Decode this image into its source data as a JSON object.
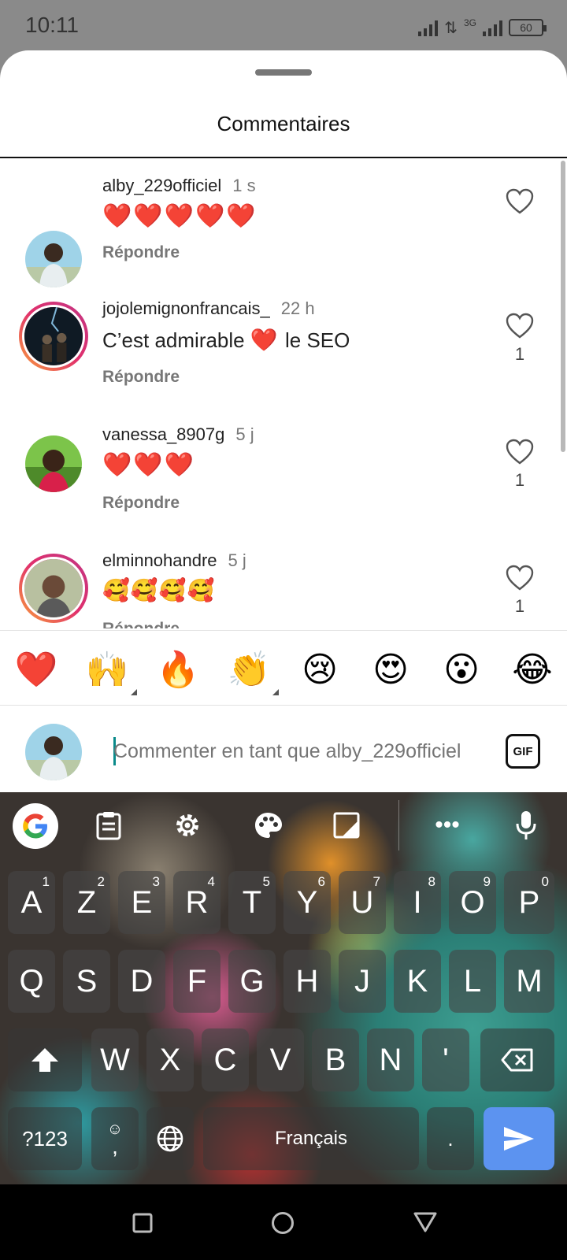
{
  "status_bar": {
    "time": "10:11",
    "network": "3G",
    "battery": "60"
  },
  "sheet": {
    "title": "Commentaires"
  },
  "comments": [
    {
      "username": "alby_229officiel",
      "ago": "1 s",
      "text": "❤️❤️❤️❤️❤️",
      "reply": "Répondre",
      "likes": ""
    },
    {
      "username": "jojolemignonfrancais_",
      "ago": "22 h",
      "text_before": "C’est admirable",
      "text_emoji": "❤️",
      "text_after": "le SEO",
      "reply": "Répondre",
      "likes": "1"
    },
    {
      "username": "vanessa_8907g",
      "ago": "5 j",
      "text": "❤️❤️❤️",
      "reply": "Répondre",
      "likes": "1"
    },
    {
      "username": "elminnohandre",
      "ago": "5 j",
      "text": "🥰🥰🥰🥰",
      "reply": "Répondre",
      "likes": "1"
    }
  ],
  "emoji_bar": [
    "❤️",
    "🙌",
    "🔥",
    "👏",
    "😢",
    "😍",
    "😮",
    "😂"
  ],
  "compose": {
    "placeholder": "Commenter en tant que alby_229officiel",
    "gif_label": "GIF"
  },
  "keyboard": {
    "row1": [
      {
        "key": "A",
        "hint": "1"
      },
      {
        "key": "Z",
        "hint": "2"
      },
      {
        "key": "E",
        "hint": "3"
      },
      {
        "key": "R",
        "hint": "4"
      },
      {
        "key": "T",
        "hint": "5"
      },
      {
        "key": "Y",
        "hint": "6"
      },
      {
        "key": "U",
        "hint": "7"
      },
      {
        "key": "I",
        "hint": "8"
      },
      {
        "key": "O",
        "hint": "9"
      },
      {
        "key": "P",
        "hint": "0"
      }
    ],
    "row2": [
      "Q",
      "S",
      "D",
      "F",
      "G",
      "H",
      "J",
      "K",
      "L",
      "M"
    ],
    "row3": [
      "W",
      "X",
      "C",
      "V",
      "B",
      "N",
      "'"
    ],
    "symbols_label": "?123",
    "comma_label": ",",
    "space_label": "Français",
    "period_label": ".",
    "colors": {
      "enter": "#5c93f0"
    }
  }
}
